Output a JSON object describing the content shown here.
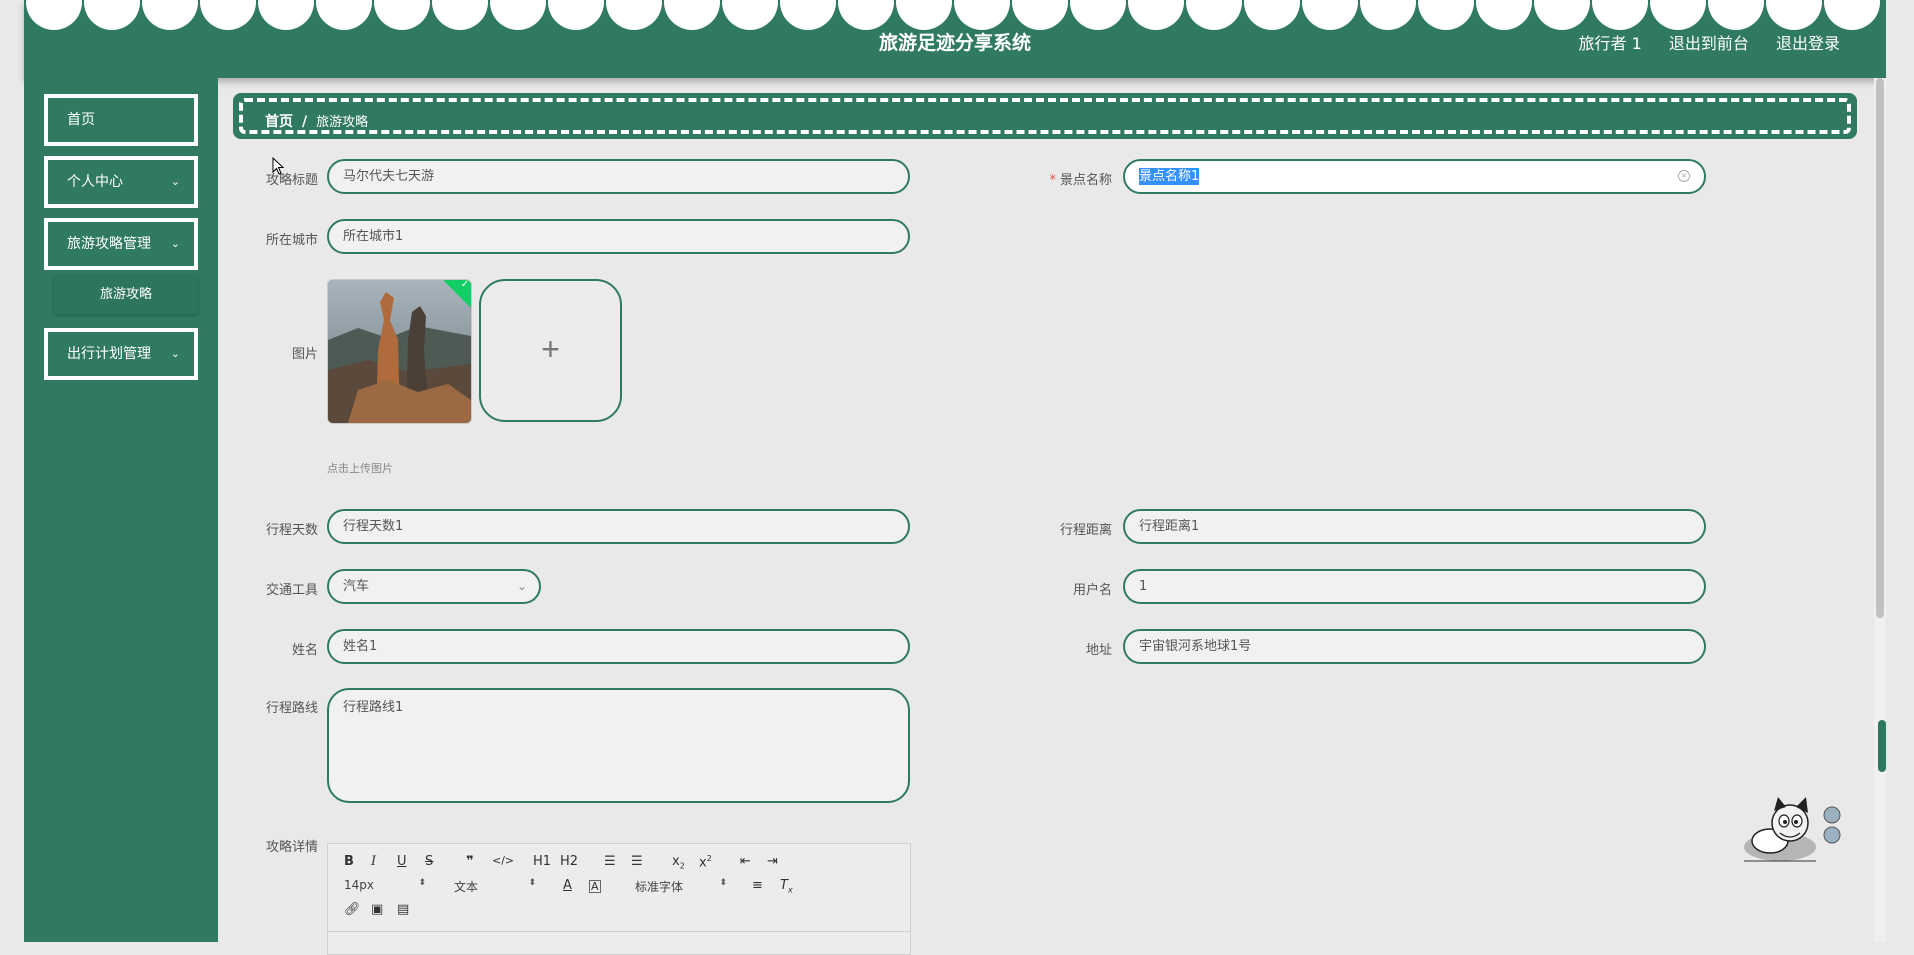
{
  "header": {
    "title": "旅游足迹分享系统",
    "user_label": "旅行者 1",
    "back_front_label": "退出到前台",
    "logout_label": "退出登录"
  },
  "sidebar": {
    "items": [
      {
        "label": "首页"
      },
      {
        "label": "个人中心"
      },
      {
        "label": "旅游攻略管理"
      },
      {
        "label": "出行计划管理"
      }
    ],
    "sub_items": [
      {
        "label": "旅游攻略"
      }
    ]
  },
  "breadcrumb": {
    "home": "首页",
    "separator": "/",
    "current": "旅游攻略"
  },
  "form": {
    "title_label": "攻略标题",
    "title_value": "马尔代夫七天游",
    "spot_label": "景点名称",
    "spot_required": "*",
    "spot_value": "景点名称1",
    "city_label": "所在城市",
    "city_value": "所在城市1",
    "image_label": "图片",
    "upload_hint": "点击上传图片",
    "days_label": "行程天数",
    "days_value": "行程天数1",
    "distance_label": "行程距离",
    "distance_value": "行程距离1",
    "transport_label": "交通工具",
    "transport_value": "汽车",
    "username_label": "用户名",
    "username_value": "1",
    "name_label": "姓名",
    "name_value": "姓名1",
    "address_label": "地址",
    "address_value": "宇宙银河系地球1号",
    "route_label": "行程路线",
    "route_value": "行程路线1",
    "details_label": "攻略详情"
  },
  "editor": {
    "font_size": "14px",
    "text_type": "文本",
    "font_family": "标准字体",
    "h1": "H1",
    "h2": "H2"
  },
  "colors": {
    "primary": "#307a61",
    "background": "#e9e9e9",
    "required": "#e84b4b",
    "upload_success": "#13ce66"
  }
}
